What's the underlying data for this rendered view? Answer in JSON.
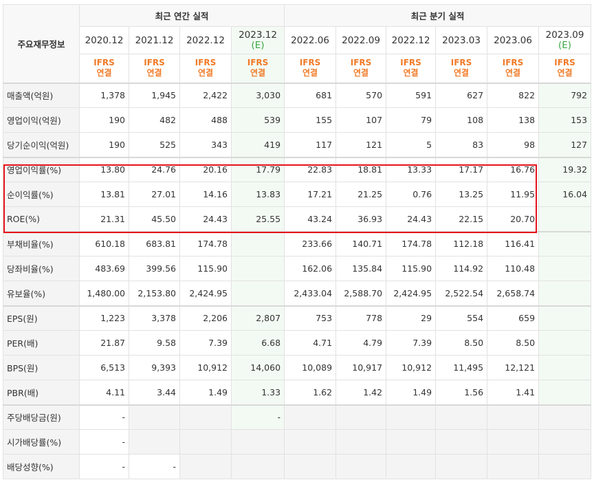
{
  "header": {
    "corner_label": "주요재무정보",
    "annual_group": "최근 연간 실적",
    "quarterly_group": "최근 분기 실적"
  },
  "periods": [
    {
      "label": "2020.12",
      "tag": "",
      "ifrs1": "IFRS",
      "ifrs2": "연결"
    },
    {
      "label": "2021.12",
      "tag": "",
      "ifrs1": "IFRS",
      "ifrs2": "연결"
    },
    {
      "label": "2022.12",
      "tag": "",
      "ifrs1": "IFRS",
      "ifrs2": "연결"
    },
    {
      "label": "2023.12",
      "tag": "(E)",
      "ifrs1": "IFRS",
      "ifrs2": "연결"
    },
    {
      "label": "2022.06",
      "tag": "",
      "ifrs1": "IFRS",
      "ifrs2": "연결"
    },
    {
      "label": "2022.09",
      "tag": "",
      "ifrs1": "IFRS",
      "ifrs2": "연결"
    },
    {
      "label": "2022.12",
      "tag": "",
      "ifrs1": "IFRS",
      "ifrs2": "연결"
    },
    {
      "label": "2023.03",
      "tag": "",
      "ifrs1": "IFRS",
      "ifrs2": "연결"
    },
    {
      "label": "2023.06",
      "tag": "",
      "ifrs1": "IFRS",
      "ifrs2": "연결"
    },
    {
      "label": "2023.09",
      "tag": "(E)",
      "ifrs1": "IFRS",
      "ifrs2": "연결"
    }
  ],
  "rows": [
    {
      "label": "매출액(억원)",
      "values": [
        "1,378",
        "1,945",
        "2,422",
        "3,030",
        "681",
        "570",
        "591",
        "627",
        "822",
        "792"
      ]
    },
    {
      "label": "영업이익(억원)",
      "values": [
        "190",
        "482",
        "488",
        "539",
        "155",
        "107",
        "79",
        "108",
        "138",
        "153"
      ]
    },
    {
      "label": "당기순이익(억원)",
      "values": [
        "190",
        "525",
        "343",
        "419",
        "117",
        "121",
        "5",
        "83",
        "98",
        "127"
      ]
    },
    {
      "label": "영업이익률(%)",
      "values": [
        "13.80",
        "24.76",
        "20.16",
        "17.79",
        "22.83",
        "18.81",
        "13.33",
        "17.17",
        "16.76",
        "19.32"
      ]
    },
    {
      "label": "순이익률(%)",
      "values": [
        "13.81",
        "27.01",
        "14.16",
        "13.83",
        "17.21",
        "21.25",
        "0.76",
        "13.25",
        "11.95",
        "16.04"
      ]
    },
    {
      "label": "ROE(%)",
      "values": [
        "21.31",
        "45.50",
        "24.43",
        "25.55",
        "43.24",
        "36.93",
        "24.43",
        "22.15",
        "20.70",
        ""
      ]
    },
    {
      "label": "부채비율(%)",
      "values": [
        "610.18",
        "683.81",
        "174.78",
        "",
        "233.66",
        "140.71",
        "174.78",
        "112.18",
        "116.41",
        ""
      ]
    },
    {
      "label": "당좌비율(%)",
      "values": [
        "483.69",
        "399.56",
        "115.90",
        "",
        "162.06",
        "135.84",
        "115.90",
        "114.92",
        "110.48",
        ""
      ]
    },
    {
      "label": "유보율(%)",
      "values": [
        "1,480.00",
        "2,153.80",
        "2,424.95",
        "",
        "2,433.04",
        "2,588.70",
        "2,424.95",
        "2,522.54",
        "2,658.74",
        ""
      ]
    },
    {
      "label": "EPS(원)",
      "values": [
        "1,223",
        "3,378",
        "2,206",
        "2,807",
        "753",
        "778",
        "29",
        "554",
        "659",
        ""
      ]
    },
    {
      "label": "PER(배)",
      "values": [
        "21.87",
        "9.58",
        "7.39",
        "6.68",
        "4.71",
        "4.79",
        "7.39",
        "8.50",
        "8.50",
        ""
      ]
    },
    {
      "label": "BPS(원)",
      "values": [
        "6,513",
        "9,393",
        "10,912",
        "14,060",
        "10,089",
        "10,917",
        "10,912",
        "11,495",
        "12,121",
        ""
      ]
    },
    {
      "label": "PBR(배)",
      "values": [
        "4.11",
        "3.44",
        "1.49",
        "1.33",
        "1.62",
        "1.42",
        "1.49",
        "1.56",
        "1.41",
        ""
      ]
    },
    {
      "label": "주당배당금(원)",
      "values": [
        "-",
        "",
        "",
        "-",
        "",
        "",
        "",
        "",
        "",
        ""
      ]
    },
    {
      "label": "시가배당률(%)",
      "values": [
        "-",
        "",
        "",
        "",
        "",
        "",
        "",
        "",
        "",
        ""
      ]
    },
    {
      "label": "배당성향(%)",
      "values": [
        "-",
        "-",
        "",
        "",
        "",
        "",
        "",
        "",
        "",
        ""
      ]
    }
  ],
  "colors": {
    "ifrs_label": "#f07a26",
    "estimate_tag": "#3aa844",
    "estimate_column_bg": "#f3faf3",
    "highlight_border": "#e5141a",
    "header_bg": "#f4f4f4"
  }
}
